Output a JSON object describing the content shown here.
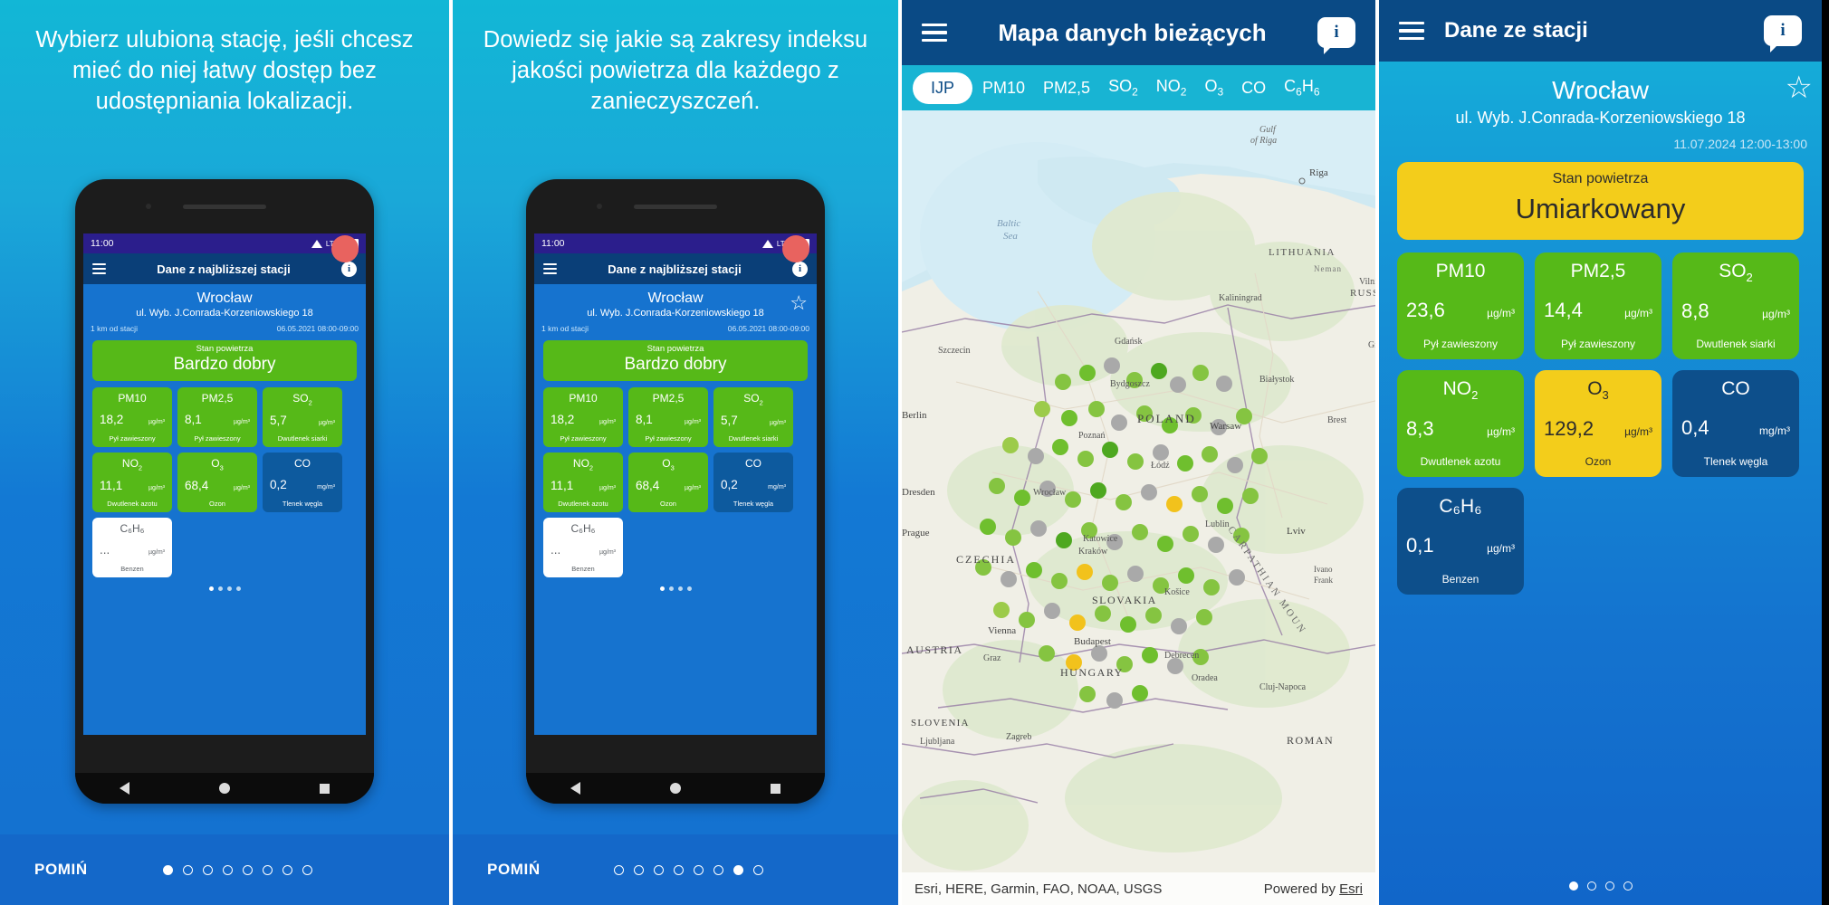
{
  "onboarding": {
    "slide1_caption": "Wybierz ulubioną stację, jeśli chcesz mieć do niej łatwy dostęp bez udostępniania lokalizacji.",
    "slide2_caption": "Dowiedz się jakie są zakresy indeksu jakości powietrza dla każdego z zanieczyszczeń.",
    "skip_label": "POMIŃ",
    "pager_count": 8,
    "slide1_active_index": 0,
    "slide2_active_index": 6
  },
  "phone": {
    "status_time": "11:00",
    "status_network": "LTE",
    "appbar_title": "Dane z najbliższej stacji",
    "info_icon": "info-icon",
    "menu_icon": "hamburger-icon",
    "station": {
      "city": "Wrocław",
      "address": "ul. Wyb. J.Conrada-Korzeniowskiego 18",
      "distance": "1 km od stacji",
      "timestamp": "06.05.2021 08:00-09:00"
    },
    "aqi": {
      "label": "Stan powietrza",
      "value": "Bardzo dobry",
      "color": "#56b918"
    },
    "tiles": [
      {
        "name": "PM10",
        "sub": "",
        "value": "18,2",
        "unit": "µg/m³",
        "desc": "Pył zawieszony",
        "style": "green"
      },
      {
        "name": "PM2,5",
        "sub": "",
        "value": "8,1",
        "unit": "µg/m³",
        "desc": "Pył zawieszony",
        "style": "green"
      },
      {
        "name": "SO",
        "sub": "2",
        "value": "5,7",
        "unit": "µg/m³",
        "desc": "Dwutlenek siarki",
        "style": "green"
      },
      {
        "name": "NO",
        "sub": "2",
        "value": "11,1",
        "unit": "µg/m³",
        "desc": "Dwutlenek azotu",
        "style": "green"
      },
      {
        "name": "O",
        "sub": "3",
        "value": "68,4",
        "unit": "µg/m³",
        "desc": "Ozon",
        "style": "green"
      },
      {
        "name": "CO",
        "sub": "",
        "value": "0,2",
        "unit": "mg/m³",
        "desc": "Tlenek węgla",
        "style": "navy"
      },
      {
        "name": "C₆H₆",
        "sub": "",
        "value": "...",
        "unit": "µg/m³",
        "desc": "Benzen",
        "style": "white-t"
      }
    ],
    "carousel_dots": 4,
    "carousel_active": 0
  },
  "map": {
    "appbar_title": "Mapa danych bieżących",
    "menu_icon": "hamburger-icon",
    "info_icon": "info-bubble-icon",
    "tabs": [
      {
        "label": "IJP",
        "sub": "",
        "active": true
      },
      {
        "label": "PM10",
        "sub": "",
        "active": false
      },
      {
        "label": "PM2,5",
        "sub": "",
        "active": false
      },
      {
        "label": "SO",
        "sub": "2",
        "active": false
      },
      {
        "label": "NO",
        "sub": "2",
        "active": false
      },
      {
        "label": "O",
        "sub": "3",
        "active": false
      },
      {
        "label": "CO",
        "sub": "",
        "active": false
      },
      {
        "label": "C",
        "sub": "6",
        "label2": "H",
        "sub2": "6",
        "active": false
      }
    ],
    "labels": [
      "Gulf of Riga",
      "Riga",
      "Baltic Sea",
      "LITHUANIA",
      "RUSSIA",
      "Kaliningrad",
      "Vilnius",
      "Grodno",
      "Gdańsk",
      "Szczecin",
      "Bydgoszcz",
      "Białystok",
      "Berlin",
      "Poznań",
      "POLAND",
      "Warsaw",
      "Brest",
      "Dresden",
      "Wrocław",
      "Łódź",
      "Lublin",
      "Lviv",
      "Prague",
      "CZECHIA",
      "Kraków",
      "Katowice",
      "Ivano Frank",
      "Vienna",
      "AUSTRIA",
      "Graz",
      "SLOVAKIA",
      "Košice",
      "Budapest",
      "Debrecen",
      "HUNGARY",
      "Oradea",
      "Cluj-Napoca",
      "SLOVENIA",
      "Ljubljana",
      "Zagreb",
      "ROMANIA",
      "CARPATHIAN MOUNTAINS"
    ],
    "attribution_left": "Esri, HERE, Garmin, FAO, NOAA, USGS",
    "attribution_right": "Powered by ",
    "attribution_right_link": "Esri"
  },
  "station_page": {
    "appbar_title": "Dane ze stacji",
    "menu_icon": "hamburger-icon",
    "info_icon": "info-bubble-icon",
    "star_icon": "star-outline-icon",
    "city": "Wrocław",
    "address": "ul. Wyb. J.Conrada-Korzeniowskiego 18",
    "timestamp": "11.07.2024 12:00-13:00",
    "aqi": {
      "label": "Stan powietrza",
      "value": "Umiarkowany",
      "color": "#f3cd1b"
    },
    "tiles": [
      {
        "name": "PM10",
        "sub": "",
        "value": "23,6",
        "unit": "µg/m³",
        "desc": "Pył zawieszony",
        "style": "green"
      },
      {
        "name": "PM2,5",
        "sub": "",
        "value": "14,4",
        "unit": "µg/m³",
        "desc": "Pył zawieszony",
        "style": "green"
      },
      {
        "name": "SO",
        "sub": "2",
        "value": "8,8",
        "unit": "µg/m³",
        "desc": "Dwutlenek siarki",
        "style": "green"
      },
      {
        "name": "NO",
        "sub": "2",
        "value": "8,3",
        "unit": "µg/m³",
        "desc": "Dwutlenek azotu",
        "style": "green"
      },
      {
        "name": "O",
        "sub": "3",
        "value": "129,2",
        "unit": "µg/m³",
        "desc": "Ozon",
        "style": "yellow"
      },
      {
        "name": "CO",
        "sub": "",
        "value": "0,4",
        "unit": "mg/m³",
        "desc": "Tlenek węgla",
        "style": "navy4"
      },
      {
        "name": "C₆H₆",
        "sub": "",
        "value": "0,1",
        "unit": "µg/m³",
        "desc": "Benzen",
        "style": "navy4"
      }
    ],
    "pager_count": 4,
    "pager_active": 0
  }
}
